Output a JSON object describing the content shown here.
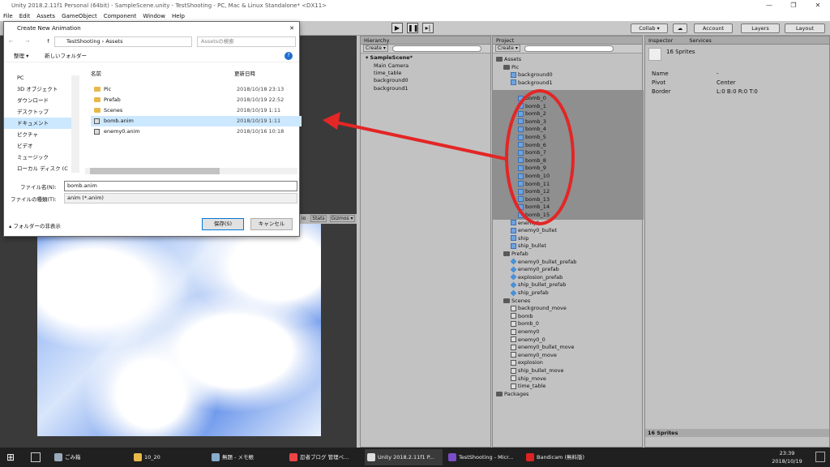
{
  "window": {
    "title": "Unity 2018.2.11f1 Personal (64bit) - SampleScene.unity - TestShooting - PC, Mac & Linux Standalone* <DX11>"
  },
  "menu": [
    "File",
    "Edit",
    "Assets",
    "GameObject",
    "Component",
    "Window",
    "Help"
  ],
  "toolbar": {
    "collab": "Collab ▾",
    "account": "Account",
    "layers": "Layers",
    "layout": "Layout"
  },
  "hierarchy": {
    "tab": "Hierarchy",
    "create": "Create ▾",
    "scene": "SampleScene*",
    "items": [
      "Main Camera",
      "time_table",
      "background0",
      "background1"
    ]
  },
  "project": {
    "tab": "Project",
    "create": "Create ▾",
    "root": "Assets",
    "pic": "Pic",
    "pic_items": [
      "background0",
      "background1"
    ],
    "bomb_sprites": [
      "bomb_0",
      "bomb_1",
      "bomb_2",
      "bomb_3",
      "bomb_4",
      "bomb_5",
      "bomb_6",
      "bomb_7",
      "bomb_8",
      "bomb_9",
      "bomb_10",
      "bomb_11",
      "bomb_12",
      "bomb_13",
      "bomb_14",
      "bomb_15"
    ],
    "pic_after": [
      "enemy0",
      "enemy0_bullet",
      "ship",
      "ship_bullet"
    ],
    "prefab": "Prefab",
    "prefab_items": [
      "enemy0_bullet_prefab",
      "enemy0_prefab",
      "explosion_prefab",
      "ship_bullet_prefab",
      "ship_prefab"
    ],
    "scenes": "Scenes",
    "loose_items": [
      "background_move",
      "bomb",
      "bomb_0",
      "enemy0",
      "enemy0_0",
      "enemy0_bullet_move",
      "enemy0_move",
      "explosion",
      "ship_bullet_move",
      "ship_move",
      "time_table"
    ],
    "packages": "Packages"
  },
  "inspector": {
    "tab": "Inspector",
    "services": "Services",
    "title": "16 Sprites",
    "name_label": "Name",
    "name_value": "-",
    "pivot_label": "Pivot",
    "pivot_value": "Center",
    "border_label": "Border",
    "border_value": "L:0 B:0 R:0 T:0",
    "footer": "16 Sprites"
  },
  "game": {
    "stats": "Stats",
    "gizmos": "Gizmos ▾",
    "io": "io"
  },
  "dialog": {
    "title": "Create New Animation",
    "path_1": "TestShooting",
    "path_2": "Assets",
    "search_placeholder": "Assetsの検索",
    "organize": "整理 ▾",
    "new_folder": "新しいフォルダー",
    "col_name": "名前",
    "col_date": "更新日時",
    "side": [
      "PC",
      "3D オブジェクト",
      "ダウンロード",
      "デスクトップ",
      "ドキュメント",
      "ピクチャ",
      "ビデオ",
      "ミュージック",
      "ローカル ディスク (C"
    ],
    "files": [
      {
        "name": "Pic",
        "date": "2018/10/18 23:13"
      },
      {
        "name": "Prefab",
        "date": "2018/10/19 22:52"
      },
      {
        "name": "Scenes",
        "date": "2018/10/19 1:11"
      },
      {
        "name": "bomb.anim",
        "date": "2018/10/19 1:11"
      },
      {
        "name": "enemy0.anim",
        "date": "2018/10/16 10:18"
      }
    ],
    "filename_label": "ファイル名(N):",
    "filename_value": "bomb.anim",
    "filetype_label": "ファイルの種類(T):",
    "filetype_value": "anim (*.anim)",
    "hide_folders": "フォルダーの非表示",
    "save": "保存(S)",
    "cancel": "キャンセル"
  },
  "taskbar": {
    "items": [
      "ごみ箱",
      "10_20",
      "無題 - メモ帳",
      "忍者ブログ 管理ペ...",
      "Unity 2018.2.11f1 P...",
      "TestShooting - Micr...",
      "Bandicam (無料版)"
    ],
    "time": "23:39",
    "date": "2018/10/19"
  },
  "colors": {
    "annotation": "#e32626",
    "selection": "#3d6fb0",
    "sky": "#4f86e8"
  }
}
